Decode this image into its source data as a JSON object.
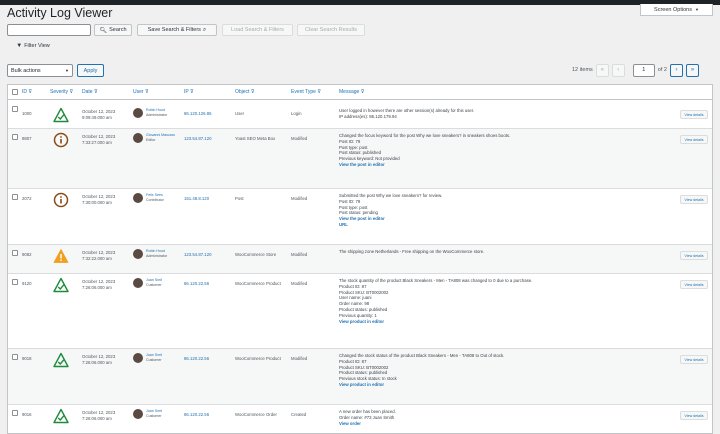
{
  "page": {
    "title": "Activity Log Viewer",
    "screen_options": "Screen Options"
  },
  "toolbar": {
    "search_value": "",
    "search_label": "Search",
    "save_label": "Save Search & Filters",
    "load_label": "Load Search & Filters",
    "clear_label": "Clear Search Results",
    "filter_label": "Filter View"
  },
  "bulk": {
    "selected": "Bulk actions",
    "apply_label": "Apply"
  },
  "pagination": {
    "items_text": "12 items",
    "first": "«",
    "prev": "‹",
    "current": "1",
    "of_text": "of 2",
    "next": "›",
    "last": "»"
  },
  "columns": {
    "id": "ID",
    "severity": "Severity",
    "date": "Date",
    "user": "User",
    "ip": "IP",
    "object": "Object",
    "event_type": "Event Type",
    "message": "Message"
  },
  "colors": {
    "accent": "#2271b1",
    "success_icon": "#1e8a3c",
    "info_icon": "#8a4b17",
    "warning_icon": "#f0a020"
  },
  "rows": [
    {
      "id": "1000",
      "severity": "check-triangle-icon",
      "date": [
        "October 12, 2023",
        "9:09:49.000 am"
      ],
      "user": [
        "Robin Hood",
        "Administrator"
      ],
      "ip": "86.120.126.86",
      "object": "User",
      "event": "Login",
      "message": [
        {
          "t": "User logged in however there are other session(s) already for this user.",
          "s": "n"
        },
        {
          "t": "IP address(es): 86.120.179.94",
          "s": "n"
        }
      ],
      "details": "View details"
    },
    {
      "id": "8807",
      "severity": "info-circle-icon",
      "date": [
        "October 12, 2023",
        "7:33:27.000 am"
      ],
      "user": [
        "Giovanni Mascaro",
        "Editor"
      ],
      "ip": "123.54.87.120",
      "object": "Yoast SEO Meta Box",
      "event": "Modified",
      "message": [
        {
          "t": "Changed the focus keyword for the post Why we love sneakers? in sneakers shoes boots.",
          "s": "n"
        },
        {
          "t": "Post ID: 79",
          "s": "n"
        },
        {
          "t": "Post type: post",
          "s": "n"
        },
        {
          "t": "Post status: published",
          "s": "n"
        },
        {
          "t": "Previous keyword: Not provided",
          "s": "n"
        },
        {
          "t": "View the post in editor",
          "s": "l"
        }
      ],
      "details": "View details"
    },
    {
      "id": "2072",
      "severity": "info-circle-icon",
      "date": [
        "October 12, 2023",
        "7:30:00.000 am"
      ],
      "user": [
        "Felix Sees",
        "Contributor"
      ],
      "ip": "151.48.8.120",
      "object": "Post",
      "event": "Modified",
      "message": [
        {
          "t": "Submitted the post Why we love sneakers? for review.",
          "s": "n"
        },
        {
          "t": "Post ID: 79",
          "s": "n"
        },
        {
          "t": "Post type: post",
          "s": "n"
        },
        {
          "t": "Post status: pending",
          "s": "n"
        },
        {
          "t": "View the post in editor",
          "s": "l"
        },
        {
          "t": "URL",
          "s": "l"
        }
      ],
      "details": "View details"
    },
    {
      "id": "9082",
      "severity": "warning-triangle-icon",
      "date": [
        "October 12, 2023",
        "7:32:22.000 am"
      ],
      "user": [
        "Robin Hood",
        "Administrator"
      ],
      "ip": "123.54.87.120",
      "object": "WooCommerce Store",
      "event": "Modified",
      "message": [
        {
          "t": "The shipping zone Netherlands - Free shipping on the WooCommerce store.",
          "s": "n"
        }
      ],
      "details": "View details"
    },
    {
      "id": "9120",
      "severity": "check-triangle-icon",
      "date": [
        "October 12, 2023",
        "7:26:06.000 am"
      ],
      "user": [
        "Juan Smit",
        "Customer"
      ],
      "ip": "86.120.22.56",
      "object": "WooCommerce Product",
      "event": "Modified",
      "message": [
        {
          "t": "The stock quantity of the product Black Sneakers - Men - TA808 was changed to 0 due to a purchase.",
          "s": "n"
        },
        {
          "t": "Product ID: 87",
          "s": "n"
        },
        {
          "t": "Product SKU: BT0002002",
          "s": "n"
        },
        {
          "t": "User name: juani",
          "s": "n"
        },
        {
          "t": "Order name: 98",
          "s": "n"
        },
        {
          "t": "Product status: published",
          "s": "n"
        },
        {
          "t": "Previous quantity: 1",
          "s": "n"
        },
        {
          "t": "View product in editor",
          "s": "l"
        }
      ],
      "details": "View details"
    },
    {
      "id": "9018",
      "severity": "check-triangle-icon",
      "date": [
        "October 12, 2023",
        "7:26:06.000 am"
      ],
      "user": [
        "Juan Smit",
        "Customer"
      ],
      "ip": "86.120.22.56",
      "object": "WooCommerce Product",
      "event": "Modified",
      "message": [
        {
          "t": "Changed the stock status of the product Black Sneakers - Men - TA808 to Out of stock.",
          "s": "n"
        },
        {
          "t": "Product ID: 87",
          "s": "n"
        },
        {
          "t": "Product SKU: BT0002002",
          "s": "n"
        },
        {
          "t": "Product status: published",
          "s": "n"
        },
        {
          "t": "Previous stock status: In stock",
          "s": "n"
        },
        {
          "t": "View product in editor",
          "s": "l"
        }
      ],
      "details": "View details"
    },
    {
      "id": "9016",
      "severity": "check-triangle-icon",
      "date": [
        "October 12, 2023",
        "7:26:06.000 am"
      ],
      "user": [
        "Juan Smit",
        "Customer"
      ],
      "ip": "86.120.22.56",
      "object": "WooCommerce Order",
      "event": "Created",
      "message": [
        {
          "t": "A new order has been placed.",
          "s": "n"
        },
        {
          "t": "Order name: #73 Juan Smith",
          "s": "n"
        },
        {
          "t": "View order",
          "s": "l"
        }
      ],
      "details": "View details"
    }
  ]
}
